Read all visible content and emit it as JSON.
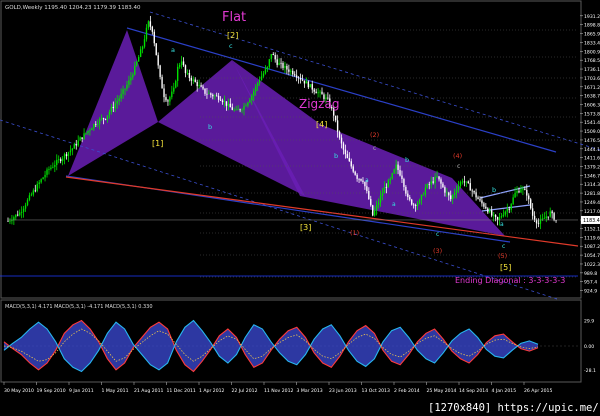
{
  "header": {
    "symbol_info": "GOLD,Weekly  1195.40  1204.23  1179.39  1183.40"
  },
  "watermark": "[1270x840] https://upic.me/",
  "colors": {
    "background": "#000000",
    "bull_candle": "#00e000",
    "bear_candle": "#ffffff",
    "wave_fill": "#6a1fb5",
    "channel_line": "#2b40c8",
    "red_trend": "#e03a2a",
    "macd_main_fill": "#3c4bd8",
    "macd_red": "#ff3b3b",
    "macd_blue": "#27b6f0",
    "price_axis_label": "#ffffff",
    "current_price_box": "#ffffff"
  },
  "chart_data": [
    {
      "type": "candlestick",
      "title": "GOLD,Weekly",
      "ohlc_readout": {
        "open": 1195.4,
        "high": 1204.23,
        "low": 1179.39,
        "close": 1183.4
      },
      "y_ticks": [
        1931.2,
        1898.8,
        1865.9,
        1833.4,
        1800.9,
        1768.5,
        1736.1,
        1703.6,
        1671.2,
        1638.7,
        1606.3,
        1573.8,
        1541.4,
        1509.0,
        1476.5,
        1444.1,
        1411.6,
        1379.2,
        1346.7,
        1314.3,
        1281.8,
        1249.4,
        1217.0,
        1183.4,
        1152.1,
        1119.6,
        1087.2,
        1054.7,
        1022.3,
        989.8,
        957.4,
        924.9
      ],
      "ylim": [
        905,
        1945
      ],
      "current_price": 1183.4,
      "x_ticks": [
        "30 May 2010",
        "19 Sep 2010",
        "9 Jan 2011",
        "1 May 2011",
        "21 Aug 2011",
        "11 Dec 2011",
        "1 Apr 2012",
        "22 Jul 2012",
        "11 Nov 2012",
        "3 Mar 2013",
        "23 Jun 2013",
        "13 Oct 2013",
        "2 Feb 2014",
        "25 May 2014",
        "14 Sep 2014",
        "4 Jan 2015",
        "26 Apr 2015"
      ],
      "price_path": [
        [
          0,
          1180
        ],
        [
          6,
          1210
        ],
        [
          11,
          1265
        ],
        [
          17,
          1330
        ],
        [
          21,
          1370
        ],
        [
          25,
          1395
        ],
        [
          29,
          1420
        ],
        [
          33,
          1445
        ],
        [
          37,
          1480
        ],
        [
          41,
          1510
        ],
        [
          45,
          1540
        ],
        [
          50,
          1560
        ],
        [
          54,
          1600
        ],
        [
          58,
          1640
        ],
        [
          62,
          1690
        ],
        [
          65,
          1740
        ],
        [
          67,
          1780
        ],
        [
          69,
          1820
        ],
        [
          71,
          1880
        ],
        [
          72,
          1905
        ],
        [
          74,
          1880
        ],
        [
          76,
          1790
        ],
        [
          78,
          1700
        ],
        [
          80,
          1640
        ],
        [
          82,
          1620
        ],
        [
          85,
          1660
        ],
        [
          87,
          1740
        ],
        [
          89,
          1770
        ],
        [
          91,
          1720
        ],
        [
          94,
          1700
        ],
        [
          97,
          1680
        ],
        [
          101,
          1650
        ],
        [
          105,
          1640
        ],
        [
          109,
          1630
        ],
        [
          113,
          1600
        ],
        [
          117,
          1580
        ],
        [
          121,
          1600
        ],
        [
          125,
          1640
        ],
        [
          129,
          1700
        ],
        [
          133,
          1740
        ],
        [
          135,
          1795
        ],
        [
          138,
          1760
        ],
        [
          142,
          1740
        ],
        [
          147,
          1720
        ],
        [
          152,
          1690
        ],
        [
          157,
          1660
        ],
        [
          161,
          1640
        ],
        [
          164,
          1620
        ],
        [
          167,
          1570
        ],
        [
          170,
          1480
        ],
        [
          173,
          1420
        ],
        [
          176,
          1380
        ],
        [
          179,
          1340
        ],
        [
          182,
          1330
        ],
        [
          185,
          1260
        ],
        [
          187,
          1200
        ],
        [
          190,
          1250
        ],
        [
          193,
          1300
        ],
        [
          196,
          1330
        ],
        [
          199,
          1380
        ],
        [
          202,
          1340
        ],
        [
          205,
          1260
        ],
        [
          208,
          1240
        ],
        [
          211,
          1250
        ],
        [
          214,
          1300
        ],
        [
          217,
          1320
        ],
        [
          220,
          1340
        ],
        [
          224,
          1290
        ],
        [
          227,
          1260
        ],
        [
          230,
          1300
        ],
        [
          233,
          1330
        ],
        [
          236,
          1310
        ],
        [
          239,
          1280
        ],
        [
          242,
          1250
        ],
        [
          245,
          1230
        ],
        [
          248,
          1200
        ],
        [
          251,
          1180
        ],
        [
          254,
          1210
        ],
        [
          257,
          1230
        ],
        [
          260,
          1280
        ],
        [
          263,
          1300
        ],
        [
          266,
          1280
        ],
        [
          269,
          1200
        ],
        [
          272,
          1170
        ],
        [
          275,
          1190
        ],
        [
          278,
          1210
        ],
        [
          281,
          1180
        ]
      ],
      "annotations": {
        "flat_label": "Flat",
        "zigzag_label": "Zigzag",
        "ending_diagonal": "Ending Diagonal : 3-3-3-3-3",
        "wave_labels": [
          "[1]",
          "[2]",
          "[3]",
          "[4]",
          "[5]"
        ],
        "sub_labels": [
          "a",
          "b",
          "c",
          "(1)",
          "(2)",
          "(3)",
          "(4)",
          "(5)"
        ]
      }
    },
    {
      "type": "line",
      "title": "MACD(5,3,1) 4.171 MACD(5,3,1) -4.171 MACD(5,3,1) 0.330",
      "y_ticks": [
        29.9,
        0.0,
        -28.1
      ],
      "ylim": [
        -40,
        40
      ],
      "series": [
        {
          "values": [
            5,
            -3,
            -10,
            -20,
            -28,
            -20,
            -5,
            15,
            25,
            30,
            20,
            5,
            -15,
            -28,
            -20,
            -2,
            10,
            22,
            28,
            20,
            -5,
            -22,
            -30,
            -18,
            -4,
            12,
            20,
            10,
            -10,
            -25,
            -20,
            -5,
            8,
            18,
            22,
            10,
            -8,
            -20,
            -25,
            -12,
            5,
            18,
            24,
            15,
            -5,
            -18,
            -22,
            -10,
            5,
            15,
            20,
            8,
            -6,
            -15,
            -20,
            -10,
            4,
            12,
            14,
            5,
            -3,
            -6,
            -2
          ]
        },
        {
          "values": [
            -5,
            3,
            10,
            20,
            28,
            20,
            5,
            -15,
            -25,
            -30,
            -20,
            -5,
            15,
            28,
            20,
            2,
            -10,
            -22,
            -28,
            -20,
            5,
            22,
            30,
            18,
            4,
            -12,
            -20,
            -10,
            10,
            25,
            20,
            5,
            -8,
            -18,
            -22,
            -10,
            8,
            20,
            25,
            12,
            -5,
            -18,
            -24,
            -15,
            5,
            18,
            22,
            10,
            -5,
            -15,
            -20,
            -8,
            6,
            15,
            20,
            10,
            -4,
            -12,
            -14,
            -5,
            3,
            6,
            2
          ]
        },
        {
          "values": [
            0,
            -2,
            -6,
            -12,
            -18,
            -16,
            -8,
            5,
            14,
            20,
            15,
            6,
            -6,
            -18,
            -14,
            -4,
            4,
            12,
            18,
            14,
            2,
            -10,
            -18,
            -12,
            -3,
            6,
            12,
            8,
            -4,
            -15,
            -12,
            -3,
            4,
            10,
            13,
            6,
            -4,
            -12,
            -15,
            -8,
            2,
            10,
            14,
            9,
            -2,
            -10,
            -13,
            -6,
            3,
            9,
            12,
            5,
            -3,
            -9,
            -12,
            -6,
            2,
            7,
            8,
            3,
            -1,
            -3,
            -1
          ]
        }
      ]
    }
  ]
}
